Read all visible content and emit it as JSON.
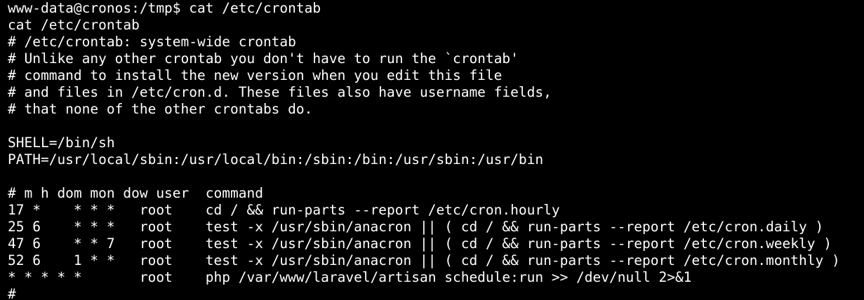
{
  "terminal": {
    "text_color": "#ffffff",
    "background_color": "#000000",
    "prompt": "www-data@cronos:/tmp$ ",
    "command": "cat /etc/crontab",
    "lines": [
      "cat /etc/crontab",
      "# /etc/crontab: system-wide crontab",
      "# Unlike any other crontab you don't have to run the `crontab'",
      "# command to install the new version when you edit this file",
      "# and files in /etc/cron.d. These files also have username fields,",
      "# that none of the other crontabs do.",
      "",
      "SHELL=/bin/sh",
      "PATH=/usr/local/sbin:/usr/local/bin:/sbin:/bin:/usr/sbin:/usr/bin",
      "",
      "# m h dom mon dow user  command",
      "17 *    * * *   root    cd / && run-parts --report /etc/cron.hourly",
      "25 6    * * *   root    test -x /usr/sbin/anacron || ( cd / && run-parts --report /etc/cron.daily )",
      "47 6    * * 7   root    test -x /usr/sbin/anacron || ( cd / && run-parts --report /etc/cron.weekly )",
      "52 6    1 * *   root    test -x /usr/sbin/anacron || ( cd / && run-parts --report /etc/cron.monthly )",
      "* * * * *       root    php /var/www/laravel/artisan schedule:run >> /dev/null 2>&1",
      "#"
    ]
  }
}
